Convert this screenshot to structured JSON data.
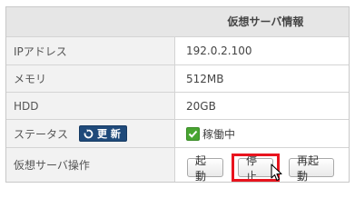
{
  "header": {
    "title": "仮想サーバ情報"
  },
  "rows": [
    {
      "label": "IPアドレス",
      "value": "192.0.2.100"
    },
    {
      "label": "メモリ",
      "value": "512MB"
    },
    {
      "label": "HDD",
      "value": "20GB"
    }
  ],
  "status": {
    "label": "ステータス",
    "update_button_label": "更 新",
    "update_icon": "refresh-icon",
    "value": "稼働中",
    "status_icon": "check-icon",
    "status_color": "#48a531"
  },
  "operations": {
    "label": "仮想サーバ操作",
    "start_label": "起動",
    "stop_label": "停止",
    "restart_label": "再起動",
    "highlight_color": "#e8141e"
  }
}
